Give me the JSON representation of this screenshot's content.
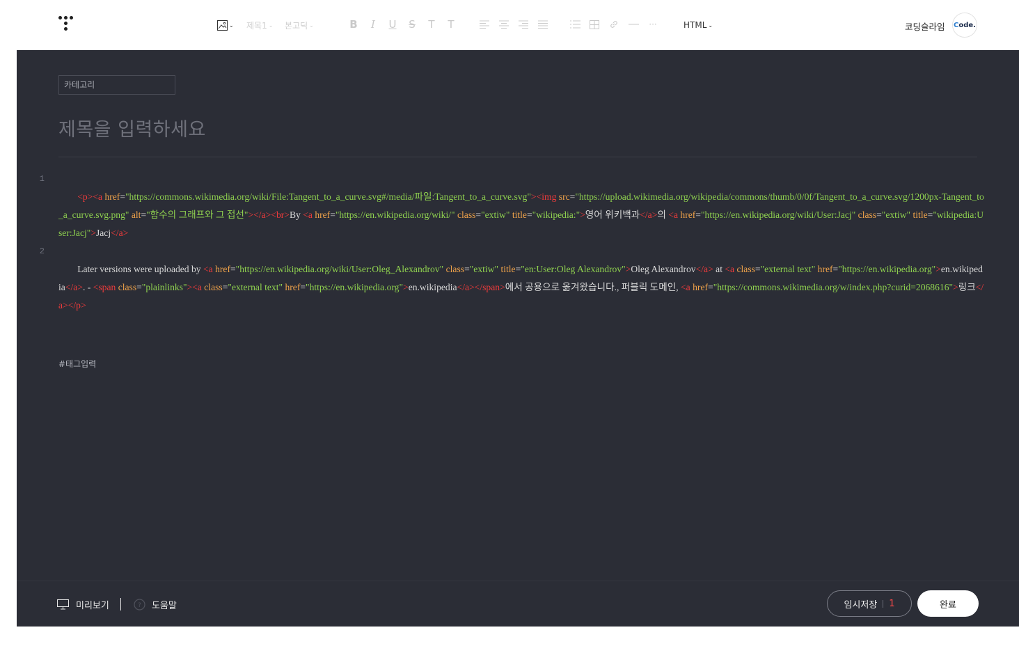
{
  "toolbar": {
    "heading_select": "제목1",
    "font_select": "본고딕",
    "mode_select": "HTML",
    "blog_name": "코딩슬라임",
    "avatar_text_accent": "C",
    "avatar_text_rest": "ode."
  },
  "editor": {
    "category_placeholder": "카테고리",
    "title_placeholder": "제목을 입력하세요",
    "line_numbers": [
      "1",
      "2"
    ],
    "tag_placeholder": "#태그입력"
  },
  "code": {
    "l1": [
      "<p>",
      "<a ",
      "href",
      "=",
      "\"https://commons.wikimedia.org/wiki/File:Tangent_to_a_curve.svg#/media/파일:Tangent_to_a_curve.svg\"",
      ">",
      "<img ",
      "src",
      "=",
      "\"https://upload.wikimedia.org/wikipedia/commons/thumb/0/0f/Tangent_to_a_curve.svg/1200px-Tangent_to_a_curve.svg.png\"",
      " ",
      "alt",
      "=",
      "\"함수의 그래프와 그 접선\"",
      "></a><br>",
      "By ",
      "<a ",
      "href",
      "=",
      "\"https://en.wikipedia.org/wiki/\"",
      " ",
      "class",
      "=",
      "\"extiw\"",
      " ",
      "title",
      "=",
      "\"wikipedia:\"",
      ">",
      "영어 위키백과",
      "</a>",
      "의 ",
      "<a ",
      "href",
      "=",
      "\"https://en.wikipedia.org/wiki/User:Jacj\"",
      " ",
      "class",
      "=",
      "\"extiw\"",
      " ",
      "title",
      "=",
      "\"wikipedia:User:Jacj\"",
      ">",
      "Jacj",
      "</a>"
    ],
    "l2": [
      "Later versions were uploaded by ",
      "<a ",
      "href",
      "=",
      "\"https://en.wikipedia.org/wiki/User:Oleg_Alexandrov\"",
      " ",
      "class",
      "=",
      "\"extiw\"",
      " ",
      "title",
      "=",
      "\"en:User:Oleg Alexandrov\"",
      ">",
      "Oleg Alexandrov",
      "</a>",
      " at ",
      "<a ",
      "class",
      "=",
      "\"external text\"",
      " ",
      "href",
      "=",
      "\"https://en.wikipedia.org\"",
      ">",
      "en.wikipedia",
      "</a>",
      ". - ",
      "<span ",
      "class",
      "=",
      "\"plainlinks\"",
      ">",
      "<a ",
      "class",
      "=",
      "\"external text\"",
      " ",
      "href",
      "=",
      "\"https://en.wikipedia.org\"",
      ">",
      "en.wikipedia",
      "</a></span>",
      "에서 공용으로 옮겨왔습니다., 퍼블릭 도메인, ",
      "<a ",
      "href",
      "=",
      "\"https://commons.wikimedia.org/w/index.php?curid=2068616\"",
      ">",
      "링크",
      "</a>",
      "</p>"
    ]
  },
  "bottom": {
    "preview_label": "미리보기",
    "help_label": "도움말",
    "draft_label": "임시저장",
    "draft_count": "1",
    "done_label": "완료"
  }
}
